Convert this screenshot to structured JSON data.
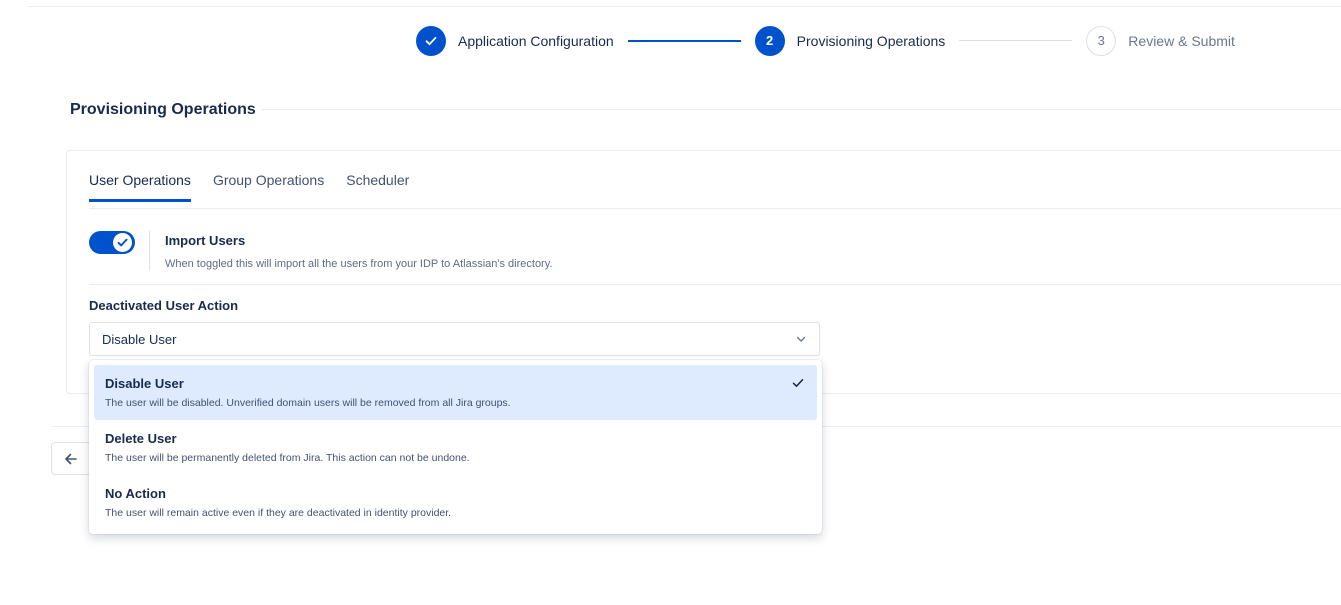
{
  "stepper": {
    "steps": [
      {
        "number": "",
        "label": "Application Configuration",
        "state": "done"
      },
      {
        "number": "2",
        "label": "Provisioning Operations",
        "state": "active"
      },
      {
        "number": "3",
        "label": "Review & Submit",
        "state": "pending"
      }
    ]
  },
  "section": {
    "title": "Provisioning Operations"
  },
  "tabs": [
    {
      "label": "User Operations",
      "active": true
    },
    {
      "label": "Group Operations",
      "active": false
    },
    {
      "label": "Scheduler",
      "active": false
    }
  ],
  "import_users": {
    "enabled": true,
    "title": "Import Users",
    "description": "When toggled this will import all the users from your IDP to Atlassian's directory."
  },
  "deactivated_action": {
    "label": "Deactivated User Action",
    "selected": "Disable User",
    "options": [
      {
        "title": "Disable User",
        "description": "The user will be disabled. Unverified domain users will be removed from all Jira groups."
      },
      {
        "title": "Delete User",
        "description": "The user will be permanently deleted from Jira. This action can not be undone."
      },
      {
        "title": "No Action",
        "description": "The user will remain active even if they are deactivated in identity provider."
      }
    ]
  },
  "colors": {
    "accent": "#0052cc",
    "selected_bg": "#deebff"
  }
}
